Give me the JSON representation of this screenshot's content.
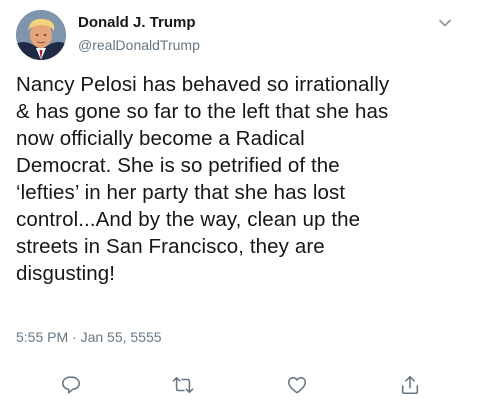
{
  "tweet": {
    "author": {
      "display_name": "Donald J. Trump",
      "handle": "@realDonaldTrump",
      "avatar_icon": "profile-photo"
    },
    "text": "Nancy Pelosi has behaved so irrationally\n& has gone so far to the left that she has\nnow officially become a Radical\nDemocrat. She is so petrified of the\n‘lefties’ in her party that she has lost\ncontrol...And by the way, clean up the\nstreets in San Francisco, they are\ndisgusting!",
    "timestamp": "5:55 PM · Jan 55, 5555",
    "actions": {
      "reply_icon": "reply-icon",
      "retweet_icon": "retweet-icon",
      "like_icon": "like-icon",
      "share_icon": "share-icon"
    },
    "menu_icon": "chevron-down-icon"
  },
  "colors": {
    "primary_text": "#14171a",
    "secondary_text": "#657786",
    "icon": "#657786"
  }
}
